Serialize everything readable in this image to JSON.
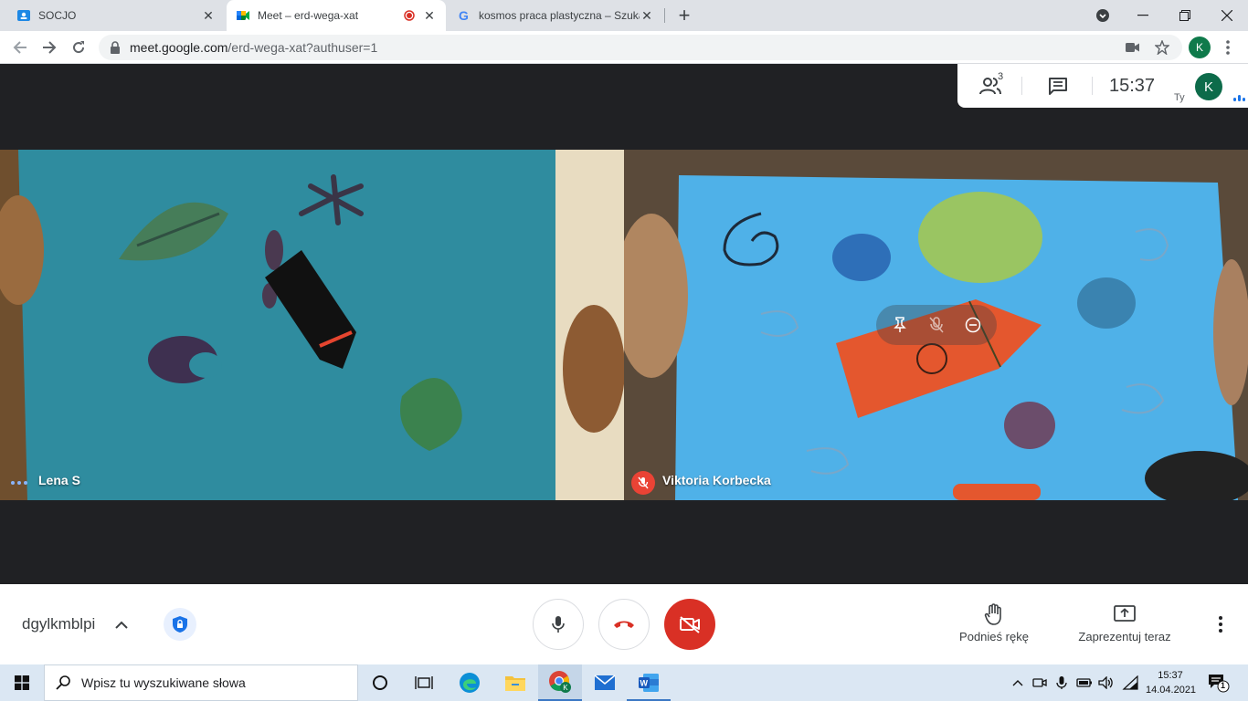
{
  "browser": {
    "tabs": [
      {
        "title": "SOCJO",
        "active": false
      },
      {
        "title": "Meet – erd-wega-xat",
        "active": true,
        "recording": true
      },
      {
        "title": "kosmos praca plastyczna – Szukaj",
        "active": false
      }
    ],
    "url_host": "meet.google.com",
    "url_path": "/erd-wega-xat?authuser=1",
    "profile_initial": "K"
  },
  "meet": {
    "participants_count": "3",
    "time": "15:37",
    "you_label": "Ty",
    "you_initial": "K",
    "meeting_code": "dgylkmblpi",
    "tiles": [
      {
        "name": "Lena S",
        "speaking": true
      },
      {
        "name": "Viktoria Korbecka",
        "muted": true
      }
    ],
    "controls": {
      "raise_hand": "Podnieś rękę",
      "present": "Zaprezentuj teraz"
    }
  },
  "taskbar": {
    "search_placeholder": "Wpisz tu wyszukiwane słowa",
    "clock_time": "15:37",
    "clock_date": "14.04.2021",
    "notification_count": "1"
  },
  "colors": {
    "meet_red": "#d93025",
    "meet_dark": "#202124",
    "accent": "#1a73e8"
  }
}
